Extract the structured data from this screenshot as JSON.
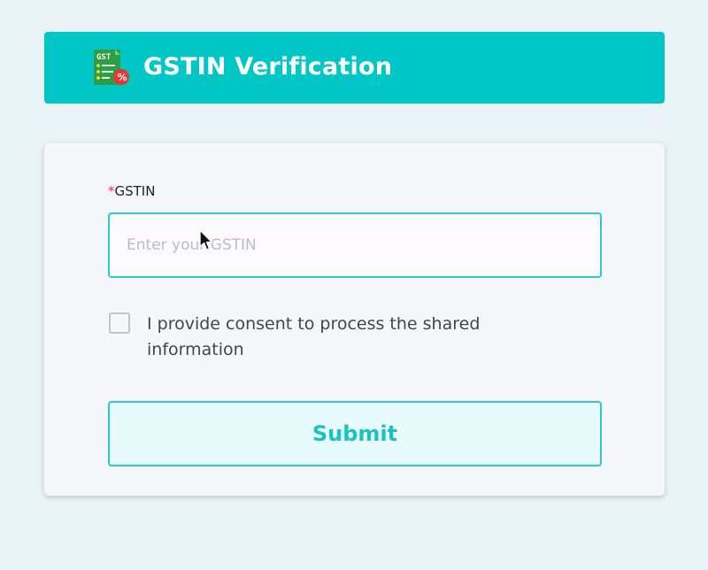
{
  "header": {
    "title": "GSTIN Verification",
    "icon": "gst-document-icon",
    "icon_text": "GST",
    "background_color": "#00c6c6"
  },
  "form": {
    "field_label": "GSTIN",
    "required_mark": "*",
    "input_placeholder": "Enter your GSTIN",
    "input_value": "",
    "consent_checked": false,
    "consent_text": "I provide consent to process the shared information",
    "submit_label": "Submit"
  },
  "colors": {
    "accent": "#2ec9cc",
    "required": "#e53935"
  }
}
